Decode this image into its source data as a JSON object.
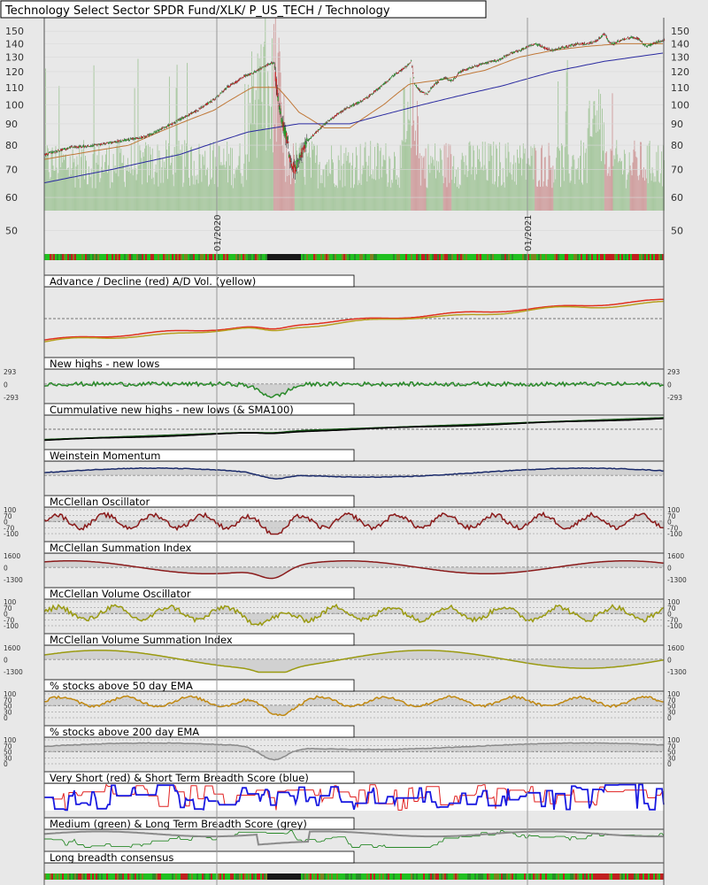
{
  "chart_data": {
    "title": "Technology Select Sector SPDR Fund/XLK/ P_US_TECH / Technology",
    "date_labels": [
      "01/2020",
      "01/2021"
    ],
    "price_panel": {
      "type": "candlestick",
      "y_scale": "log",
      "ylim": [
        45,
        160
      ],
      "tick_labels": [
        50,
        60,
        70,
        80,
        90,
        100,
        110,
        120,
        130,
        140,
        150
      ],
      "close_path": [
        [
          0,
          76
        ],
        [
          30,
          79
        ],
        [
          60,
          80
        ],
        [
          90,
          82
        ],
        [
          120,
          84
        ],
        [
          150,
          90
        ],
        [
          180,
          97
        ],
        [
          200,
          103
        ],
        [
          215,
          110
        ],
        [
          225,
          113
        ],
        [
          235,
          117
        ],
        [
          245,
          119
        ],
        [
          255,
          122
        ],
        [
          263,
          125
        ],
        [
          270,
          126
        ],
        [
          275,
          103
        ],
        [
          280,
          90
        ],
        [
          286,
          82
        ],
        [
          290,
          72
        ],
        [
          295,
          70
        ],
        [
          300,
          74
        ],
        [
          310,
          82
        ],
        [
          320,
          86
        ],
        [
          330,
          90
        ],
        [
          345,
          95
        ],
        [
          360,
          99
        ],
        [
          380,
          104
        ],
        [
          395,
          110
        ],
        [
          410,
          117
        ],
        [
          425,
          123
        ],
        [
          432,
          127
        ],
        [
          436,
          112
        ],
        [
          442,
          108
        ],
        [
          450,
          106
        ],
        [
          460,
          112
        ],
        [
          470,
          116
        ],
        [
          480,
          114
        ],
        [
          490,
          120
        ],
        [
          505,
          123
        ],
        [
          520,
          126
        ],
        [
          535,
          128
        ],
        [
          550,
          133
        ],
        [
          560,
          135
        ],
        [
          570,
          138
        ],
        [
          578,
          140
        ],
        [
          585,
          138
        ],
        [
          592,
          136
        ],
        [
          600,
          135
        ],
        [
          615,
          138
        ],
        [
          630,
          140
        ],
        [
          640,
          140
        ],
        [
          650,
          142
        ],
        [
          655,
          145
        ],
        [
          660,
          148
        ],
        [
          665,
          141
        ],
        [
          670,
          140
        ],
        [
          680,
          143
        ],
        [
          690,
          145
        ],
        [
          700,
          144
        ],
        [
          705,
          140
        ],
        [
          710,
          138
        ],
        [
          720,
          141
        ],
        [
          730,
          143
        ]
      ],
      "sma_series": [
        {
          "color": "#c07838",
          "path": [
            [
              0,
              74
            ],
            [
              100,
              80
            ],
            [
              200,
              97
            ],
            [
              245,
              110
            ],
            [
              275,
              110
            ],
            [
              300,
              96
            ],
            [
              330,
              88
            ],
            [
              360,
              88
            ],
            [
              400,
              100
            ],
            [
              430,
              112
            ],
            [
              470,
              115
            ],
            [
              520,
              121
            ],
            [
              560,
              130
            ],
            [
              600,
              135
            ],
            [
              640,
              138
            ],
            [
              680,
              140
            ],
            [
              730,
              140
            ]
          ]
        },
        {
          "color": "#2a2aa0",
          "path": [
            [
              0,
              65
            ],
            [
              80,
              70
            ],
            [
              160,
              76
            ],
            [
              240,
              86
            ],
            [
              300,
              90
            ],
            [
              360,
              90
            ],
            [
              420,
              97
            ],
            [
              480,
              104
            ],
            [
              540,
              111
            ],
            [
              600,
              120
            ],
            [
              660,
              127
            ],
            [
              730,
              133
            ]
          ]
        }
      ]
    },
    "indicator_panels": [
      {
        "label": "Advance / Decline (red) A/D Vol. (yellow)",
        "type": "line",
        "colors": [
          "#e03020",
          "#b8a020"
        ]
      },
      {
        "label": "New highs - new lows",
        "type": "line",
        "colors": [
          "#2a8a2a"
        ],
        "left_ticks": [
          "293",
          "0",
          "-293"
        ],
        "right_ticks": [
          "293",
          "0",
          "-293"
        ]
      },
      {
        "label": "Cummulative new highs - new lows (& SMA100)",
        "type": "line",
        "colors": [
          "#1a5a1a",
          "#000000"
        ]
      },
      {
        "label": "Weinstein Momentum",
        "type": "line",
        "colors": [
          "#1a2a6a"
        ]
      },
      {
        "label": "McClellan Oscillator",
        "type": "line",
        "colors": [
          "#8a1a1a"
        ],
        "left_ticks": [
          "100",
          "70",
          "0",
          "-70",
          "-100"
        ],
        "right_ticks": [
          "100",
          "70",
          "0",
          "-70",
          "-100"
        ]
      },
      {
        "label": "McClellan Summation Index",
        "type": "line",
        "colors": [
          "#8a1a1a"
        ],
        "left_ticks": [
          "1600",
          "0",
          "-1300"
        ],
        "right_ticks": [
          "1600",
          "0",
          "-1300"
        ]
      },
      {
        "label": "McClellan Volume Oscillator",
        "type": "line",
        "colors": [
          "#9a9a10"
        ],
        "left_ticks": [
          "100",
          "70",
          "0",
          "-70",
          "-100"
        ],
        "right_ticks": [
          "100",
          "70",
          "0",
          "-70",
          "-100"
        ]
      },
      {
        "label": "McClellan Volume Summation Index",
        "type": "line",
        "colors": [
          "#9a9a10"
        ],
        "left_ticks": [
          "1600",
          "0",
          "-1300"
        ],
        "right_ticks": [
          "1600",
          "0",
          "-1300"
        ]
      },
      {
        "label": "% stocks above 50 day EMA",
        "type": "line",
        "colors": [
          "#c08810"
        ],
        "left_ticks": [
          "100",
          "70",
          "50",
          "30",
          "0"
        ],
        "right_ticks": [
          "100",
          "70",
          "50",
          "30",
          "0"
        ]
      },
      {
        "label": "% stocks above 200 day EMA",
        "type": "line",
        "colors": [
          "#8a8a8a"
        ],
        "left_ticks": [
          "100",
          "70",
          "50",
          "30",
          "0"
        ],
        "right_ticks": [
          "100",
          "70",
          "50",
          "30",
          "0"
        ]
      },
      {
        "label": "Very Short (red) & Short Term Breadth Score (blue)",
        "type": "line",
        "colors": [
          "#e02020",
          "#1a1ae0"
        ]
      },
      {
        "label": "Medium (green) & Long Term Breadth Score (grey)",
        "type": "line",
        "colors": [
          "#2a8a2a",
          "#8a8a8a"
        ]
      },
      {
        "label": "Long breadth consensus",
        "type": "strip",
        "colors": [
          "#20c020",
          "#c02020",
          "#202020"
        ]
      }
    ]
  }
}
